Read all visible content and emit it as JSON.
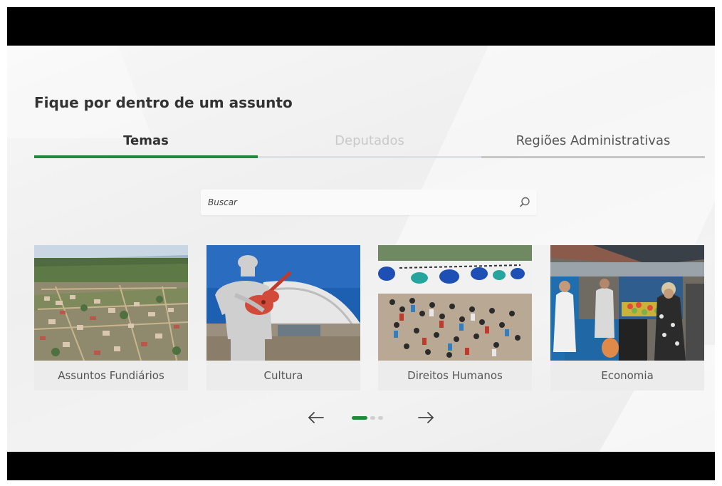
{
  "section": {
    "title": "Fique por dentro de um assunto"
  },
  "tabs": [
    {
      "label": "Temas",
      "active": true
    },
    {
      "label": "Deputados",
      "active": false
    },
    {
      "label": "Regiões Administrativas",
      "active": false
    }
  ],
  "search": {
    "placeholder": "Buscar",
    "value": "",
    "icon": "search-icon"
  },
  "cards": [
    {
      "label": "Assuntos Fundiários",
      "image": "aerial-town-photo"
    },
    {
      "label": "Cultura",
      "image": "guitar-statue-photo"
    },
    {
      "label": "Direitos Humanos",
      "image": "crowd-event-photo"
    },
    {
      "label": "Economia",
      "image": "street-market-photo"
    }
  ],
  "pager": {
    "prev_icon": "arrow-left-icon",
    "next_icon": "arrow-right-icon",
    "current_page": 1,
    "total_pages": 3
  },
  "colors": {
    "accent": "#1f8a3b",
    "frame": "#000000"
  }
}
